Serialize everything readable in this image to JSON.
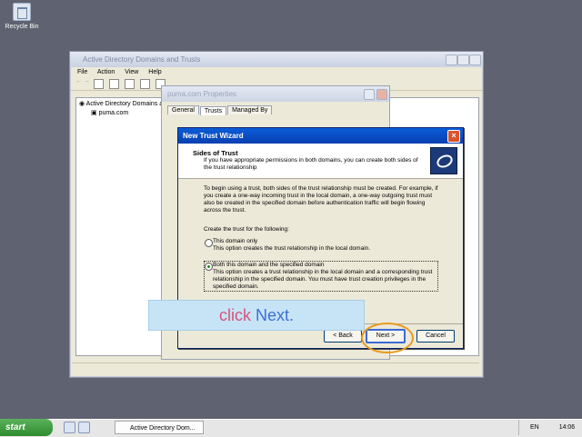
{
  "desktop": {
    "recycle_bin_label": "Recycle Bin"
  },
  "main_window": {
    "title": "Active Directory Domains and Trusts",
    "menu": [
      "File",
      "Action",
      "View",
      "Help"
    ],
    "tree": {
      "root": "Active Directory Domains and",
      "child": "puma.com"
    }
  },
  "properties_dialog": {
    "title": "puma.com Properties",
    "tabs": [
      "General",
      "Trusts",
      "Managed By"
    ]
  },
  "wizard": {
    "title": "New Trust Wizard",
    "header_title": "Sides of Trust",
    "header_subtitle": "If you have appropriate permissions in both domains, you can create both sides of the trust relationship",
    "intro": "To begin using a trust, both sides of the trust relationship must be created. For example, if you create a one-way incoming trust in the local domain, a one-way outgoing trust must also be created in the specified domain before authentication traffic will begin flowing across the trust.",
    "prompt": "Create the trust for the following:",
    "options": [
      {
        "label": "This domain only",
        "desc": "This option creates the trust relationship in the local domain.",
        "selected": false
      },
      {
        "label": "Both this domain and the specified domain",
        "desc": "This option creates a trust relationship in the local domain and a corresponding trust relationship in the specified domain. You must have trust creation privileges in the specified domain.",
        "selected": true
      }
    ],
    "buttons": {
      "back": "< Back",
      "next": "Next >",
      "cancel": "Cancel"
    }
  },
  "callout": {
    "word1": "click",
    "word2": "Next."
  },
  "taskbar": {
    "start_label": "start",
    "task_label": "Active Directory Dom...",
    "language": "EN",
    "clock": "14:06"
  },
  "colors": {
    "wizard_title": "#0a3fb0",
    "callout_bg": "#c7e4f6",
    "highlight_ring": "#e79a1e",
    "start_green": "#2f8a2f"
  }
}
